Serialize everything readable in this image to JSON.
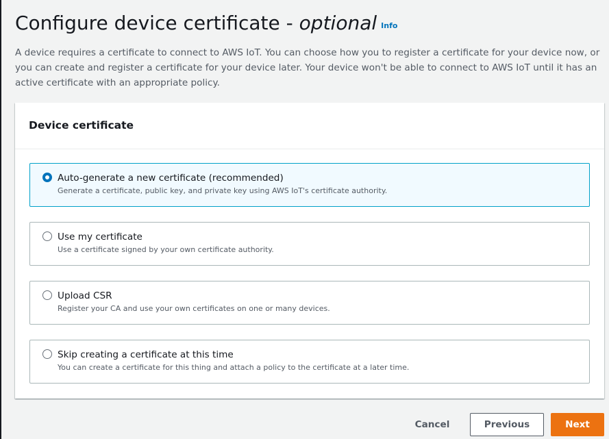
{
  "header": {
    "title_main": "Configure device certificate - ",
    "title_optional": "optional",
    "info_link": "Info",
    "description": "A device requires a certificate to connect to AWS IoT. You can choose how you to register a certificate for your device now, or you can create and register a certificate for your device later. Your device won't be able to connect to AWS IoT until it has an active certificate with an appropriate policy."
  },
  "container": {
    "title": "Device certificate",
    "options": [
      {
        "label": "Auto-generate a new certificate (recommended)",
        "description": "Generate a certificate, public key, and private key using AWS IoT's certificate authority.",
        "selected": true
      },
      {
        "label": "Use my certificate",
        "description": "Use a certificate signed by your own certificate authority.",
        "selected": false
      },
      {
        "label": "Upload CSR",
        "description": "Register your CA and use your own certificates on one or many devices.",
        "selected": false
      },
      {
        "label": "Skip creating a certificate at this time",
        "description": "You can create a certificate for this thing and attach a policy to the certificate at a later time.",
        "selected": false
      }
    ]
  },
  "actions": {
    "cancel_label": "Cancel",
    "previous_label": "Previous",
    "next_label": "Next"
  },
  "colors": {
    "primary_button": "#ec7211",
    "link": "#0073bb",
    "selected_border": "#00a1c9",
    "selected_background": "#f1faff"
  }
}
